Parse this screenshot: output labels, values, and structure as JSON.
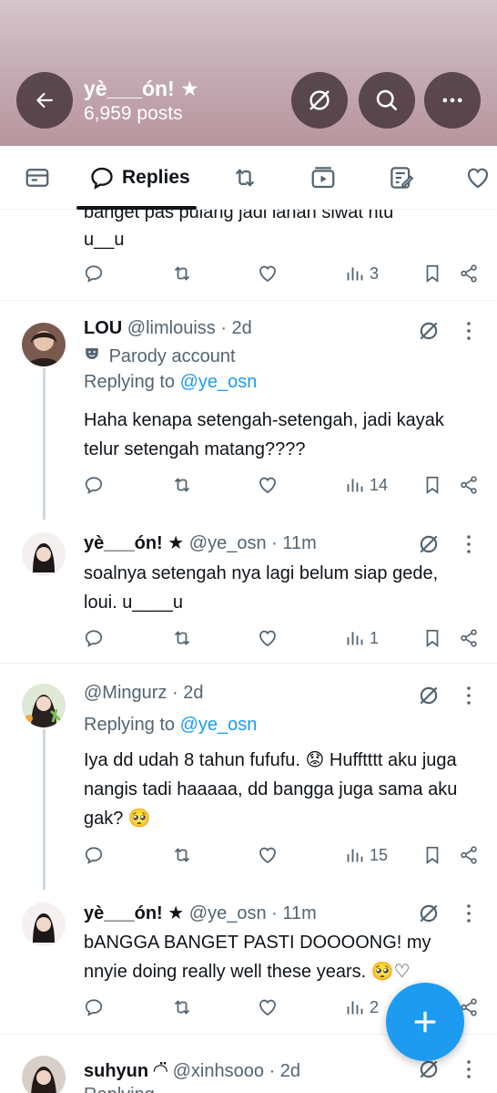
{
  "header": {
    "title": "yè___ón! ★",
    "post_count": "6,959 posts",
    "back_icon": "arrow-left-icon",
    "grok_icon": "grok-icon",
    "search_icon": "search-icon",
    "more_icon": "more-horizontal-icon"
  },
  "tabs": [
    {
      "label": "",
      "icon": "posts-tab-icon"
    },
    {
      "label": "Replies",
      "icon": "reply-icon"
    },
    {
      "label": "",
      "icon": "retweet-icon"
    },
    {
      "label": "",
      "icon": "video-icon"
    },
    {
      "label": "",
      "icon": "articles-icon"
    },
    {
      "label": "",
      "icon": "heart-icon"
    }
  ],
  "partial_post": {
    "text_line1": "banget pas pulang jadi lanan siwat ntu",
    "text_line2": "u__u",
    "views": "3"
  },
  "posts": [
    {
      "name": "LOU",
      "handle": "@limlouiss",
      "time": "· 2d",
      "badge": "Parody account",
      "replying_prefix": "Replying to ",
      "replying_to": "@ye_osn",
      "text": "Haha kenapa setengah-setengah, jadi kayak telur setengah matang????",
      "views": "14"
    },
    {
      "name": "yè___ón! ★",
      "handle": "@ye_osn",
      "time": "· 11m",
      "text": "soalnya setengah nya lagi belum siap gede, loui. u____u",
      "views": "1"
    },
    {
      "name": "",
      "handle": "@Mingurz",
      "time": "· 2d",
      "replying_prefix": "Replying to ",
      "replying_to": "@ye_osn",
      "text": "Iya dd udah 8 tahun fufufu. 😟 Hufftttt aku juga nangis tadi haaaaa, dd bangga juga sama aku gak? 🥺",
      "views": "15"
    },
    {
      "name": "yè___ón! ★",
      "handle": "@ye_osn",
      "time": "· 11m",
      "text": "bANGGA BANGET PASTI DOOOONG! my nnyie doing really well these years. 🥺♡",
      "views": "2"
    },
    {
      "name": "suhyun ◠̈",
      "handle": "@xinhsooo",
      "time": "· 2d",
      "text": "Replying..."
    }
  ],
  "fab_icon": "compose-plus-icon"
}
